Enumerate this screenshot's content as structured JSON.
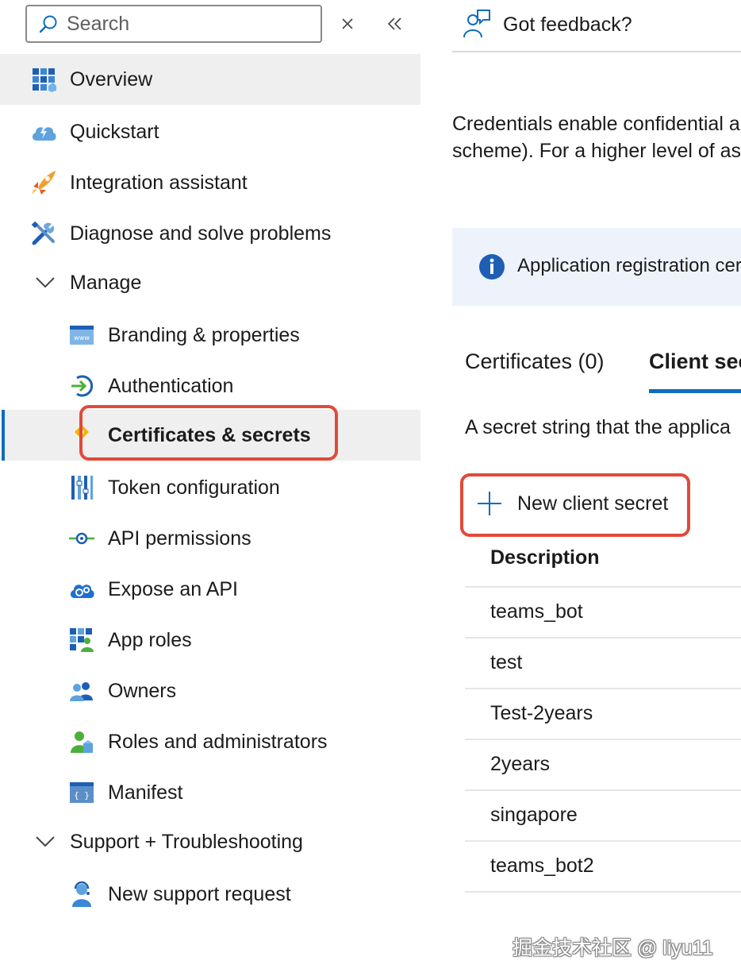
{
  "search": {
    "placeholder": "Search"
  },
  "nav": {
    "overview": "Overview",
    "quickstart": "Quickstart",
    "integration_assistant": "Integration assistant",
    "diagnose": "Diagnose and solve problems",
    "manage": "Manage",
    "branding": "Branding & properties",
    "authentication": "Authentication",
    "certificates": "Certificates & secrets",
    "token": "Token configuration",
    "api_permissions": "API permissions",
    "expose_api": "Expose an API",
    "app_roles": "App roles",
    "owners": "Owners",
    "roles_admins": "Roles and administrators",
    "manifest": "Manifest",
    "support": "Support + Troubleshooting",
    "new_support": "New support request"
  },
  "header": {
    "feedback": "Got feedback?"
  },
  "main": {
    "desc_line1": "Credentials enable confidential a",
    "desc_line2": "scheme). For a higher level of as",
    "info": "Application registration cer",
    "tabs": [
      "Certificates (0)",
      "Client sec"
    ],
    "sub_text": "A secret string that the applica",
    "new_secret": "New client secret",
    "column_header": "Description",
    "rows": [
      "teams_bot",
      "test",
      "Test-2years",
      "2years",
      "singapore",
      "teams_bot2"
    ]
  },
  "watermark": "掘金技术社区 @ liyu11",
  "colors": {
    "accent": "#0f6cbd",
    "highlight": "#e04a3a",
    "selected_bg": "#efefef",
    "info_bg": "#eef3fb"
  }
}
